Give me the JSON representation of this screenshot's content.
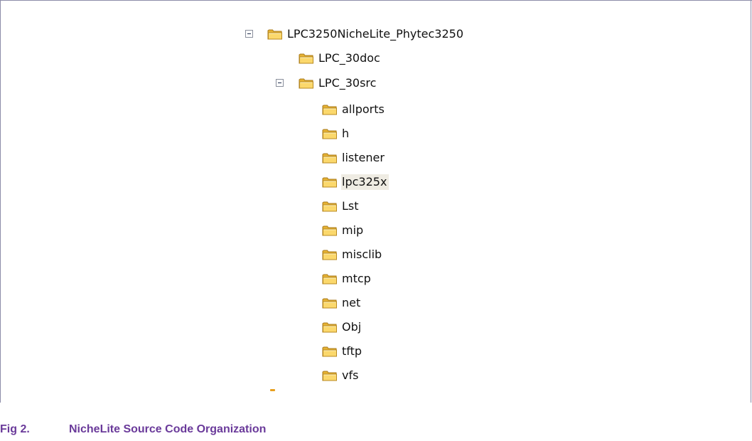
{
  "tree": {
    "root": {
      "label": "LPC3250NicheLite_Phytec3250",
      "expanded": true
    },
    "doc_folder": {
      "label": "LPC_30doc"
    },
    "src_folder": {
      "label": "LPC_30src",
      "expanded": true
    },
    "children": [
      {
        "label": "allports",
        "selected": false
      },
      {
        "label": "h",
        "selected": false
      },
      {
        "label": "listener",
        "selected": false
      },
      {
        "label": "lpc325x",
        "selected": true
      },
      {
        "label": "Lst",
        "selected": false
      },
      {
        "label": "mip",
        "selected": false
      },
      {
        "label": "misclib",
        "selected": false
      },
      {
        "label": "mtcp",
        "selected": false
      },
      {
        "label": "net",
        "selected": false
      },
      {
        "label": "Obj",
        "selected": false
      },
      {
        "label": "tftp",
        "selected": false
      },
      {
        "label": "vfs",
        "selected": false
      }
    ],
    "icon": "folder-icon",
    "expander_icon": "collapse-minus-icon",
    "folder_color": "#f0c246",
    "selection_color": "#efece3"
  },
  "caption": {
    "number": "Fig 2.",
    "title": "NicheLite Source Code Organization",
    "color": "#6a3a9a"
  }
}
